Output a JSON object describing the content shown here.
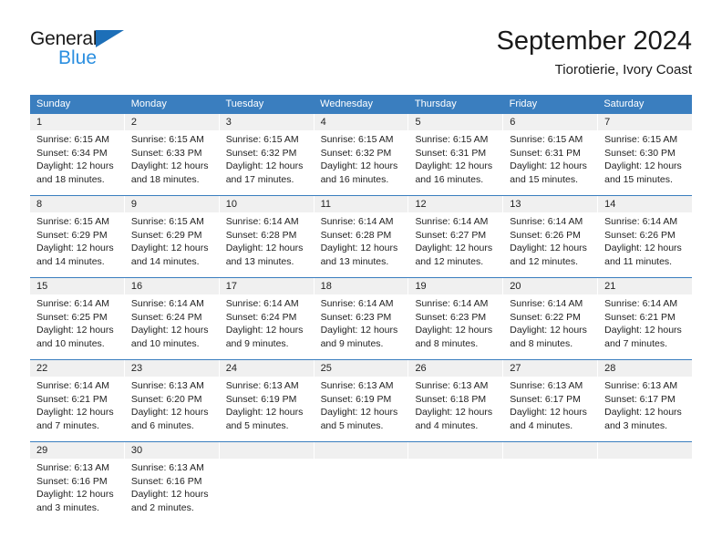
{
  "brand": {
    "line1": "General",
    "line2": "Blue",
    "triangle_color": "#1d6fb8",
    "blue_text_color": "#2b8fe0"
  },
  "header": {
    "title": "September 2024",
    "subtitle": "Tiorotierie, Ivory Coast"
  },
  "theme": {
    "header_blue": "#3a7ebf",
    "day_number_bg": "#f0f0f0",
    "text_color": "#222222"
  },
  "calendar": {
    "weekday_headers": [
      "Sunday",
      "Monday",
      "Tuesday",
      "Wednesday",
      "Thursday",
      "Friday",
      "Saturday"
    ],
    "weeks": [
      [
        {
          "day": "1",
          "sunrise": "Sunrise: 6:15 AM",
          "sunset": "Sunset: 6:34 PM",
          "daylight_1": "Daylight: 12 hours",
          "daylight_2": "and 18 minutes."
        },
        {
          "day": "2",
          "sunrise": "Sunrise: 6:15 AM",
          "sunset": "Sunset: 6:33 PM",
          "daylight_1": "Daylight: 12 hours",
          "daylight_2": "and 18 minutes."
        },
        {
          "day": "3",
          "sunrise": "Sunrise: 6:15 AM",
          "sunset": "Sunset: 6:32 PM",
          "daylight_1": "Daylight: 12 hours",
          "daylight_2": "and 17 minutes."
        },
        {
          "day": "4",
          "sunrise": "Sunrise: 6:15 AM",
          "sunset": "Sunset: 6:32 PM",
          "daylight_1": "Daylight: 12 hours",
          "daylight_2": "and 16 minutes."
        },
        {
          "day": "5",
          "sunrise": "Sunrise: 6:15 AM",
          "sunset": "Sunset: 6:31 PM",
          "daylight_1": "Daylight: 12 hours",
          "daylight_2": "and 16 minutes."
        },
        {
          "day": "6",
          "sunrise": "Sunrise: 6:15 AM",
          "sunset": "Sunset: 6:31 PM",
          "daylight_1": "Daylight: 12 hours",
          "daylight_2": "and 15 minutes."
        },
        {
          "day": "7",
          "sunrise": "Sunrise: 6:15 AM",
          "sunset": "Sunset: 6:30 PM",
          "daylight_1": "Daylight: 12 hours",
          "daylight_2": "and 15 minutes."
        }
      ],
      [
        {
          "day": "8",
          "sunrise": "Sunrise: 6:15 AM",
          "sunset": "Sunset: 6:29 PM",
          "daylight_1": "Daylight: 12 hours",
          "daylight_2": "and 14 minutes."
        },
        {
          "day": "9",
          "sunrise": "Sunrise: 6:15 AM",
          "sunset": "Sunset: 6:29 PM",
          "daylight_1": "Daylight: 12 hours",
          "daylight_2": "and 14 minutes."
        },
        {
          "day": "10",
          "sunrise": "Sunrise: 6:14 AM",
          "sunset": "Sunset: 6:28 PM",
          "daylight_1": "Daylight: 12 hours",
          "daylight_2": "and 13 minutes."
        },
        {
          "day": "11",
          "sunrise": "Sunrise: 6:14 AM",
          "sunset": "Sunset: 6:28 PM",
          "daylight_1": "Daylight: 12 hours",
          "daylight_2": "and 13 minutes."
        },
        {
          "day": "12",
          "sunrise": "Sunrise: 6:14 AM",
          "sunset": "Sunset: 6:27 PM",
          "daylight_1": "Daylight: 12 hours",
          "daylight_2": "and 12 minutes."
        },
        {
          "day": "13",
          "sunrise": "Sunrise: 6:14 AM",
          "sunset": "Sunset: 6:26 PM",
          "daylight_1": "Daylight: 12 hours",
          "daylight_2": "and 12 minutes."
        },
        {
          "day": "14",
          "sunrise": "Sunrise: 6:14 AM",
          "sunset": "Sunset: 6:26 PM",
          "daylight_1": "Daylight: 12 hours",
          "daylight_2": "and 11 minutes."
        }
      ],
      [
        {
          "day": "15",
          "sunrise": "Sunrise: 6:14 AM",
          "sunset": "Sunset: 6:25 PM",
          "daylight_1": "Daylight: 12 hours",
          "daylight_2": "and 10 minutes."
        },
        {
          "day": "16",
          "sunrise": "Sunrise: 6:14 AM",
          "sunset": "Sunset: 6:24 PM",
          "daylight_1": "Daylight: 12 hours",
          "daylight_2": "and 10 minutes."
        },
        {
          "day": "17",
          "sunrise": "Sunrise: 6:14 AM",
          "sunset": "Sunset: 6:24 PM",
          "daylight_1": "Daylight: 12 hours",
          "daylight_2": "and 9 minutes."
        },
        {
          "day": "18",
          "sunrise": "Sunrise: 6:14 AM",
          "sunset": "Sunset: 6:23 PM",
          "daylight_1": "Daylight: 12 hours",
          "daylight_2": "and 9 minutes."
        },
        {
          "day": "19",
          "sunrise": "Sunrise: 6:14 AM",
          "sunset": "Sunset: 6:23 PM",
          "daylight_1": "Daylight: 12 hours",
          "daylight_2": "and 8 minutes."
        },
        {
          "day": "20",
          "sunrise": "Sunrise: 6:14 AM",
          "sunset": "Sunset: 6:22 PM",
          "daylight_1": "Daylight: 12 hours",
          "daylight_2": "and 8 minutes."
        },
        {
          "day": "21",
          "sunrise": "Sunrise: 6:14 AM",
          "sunset": "Sunset: 6:21 PM",
          "daylight_1": "Daylight: 12 hours",
          "daylight_2": "and 7 minutes."
        }
      ],
      [
        {
          "day": "22",
          "sunrise": "Sunrise: 6:14 AM",
          "sunset": "Sunset: 6:21 PM",
          "daylight_1": "Daylight: 12 hours",
          "daylight_2": "and 7 minutes."
        },
        {
          "day": "23",
          "sunrise": "Sunrise: 6:13 AM",
          "sunset": "Sunset: 6:20 PM",
          "daylight_1": "Daylight: 12 hours",
          "daylight_2": "and 6 minutes."
        },
        {
          "day": "24",
          "sunrise": "Sunrise: 6:13 AM",
          "sunset": "Sunset: 6:19 PM",
          "daylight_1": "Daylight: 12 hours",
          "daylight_2": "and 5 minutes."
        },
        {
          "day": "25",
          "sunrise": "Sunrise: 6:13 AM",
          "sunset": "Sunset: 6:19 PM",
          "daylight_1": "Daylight: 12 hours",
          "daylight_2": "and 5 minutes."
        },
        {
          "day": "26",
          "sunrise": "Sunrise: 6:13 AM",
          "sunset": "Sunset: 6:18 PM",
          "daylight_1": "Daylight: 12 hours",
          "daylight_2": "and 4 minutes."
        },
        {
          "day": "27",
          "sunrise": "Sunrise: 6:13 AM",
          "sunset": "Sunset: 6:17 PM",
          "daylight_1": "Daylight: 12 hours",
          "daylight_2": "and 4 minutes."
        },
        {
          "day": "28",
          "sunrise": "Sunrise: 6:13 AM",
          "sunset": "Sunset: 6:17 PM",
          "daylight_1": "Daylight: 12 hours",
          "daylight_2": "and 3 minutes."
        }
      ],
      [
        {
          "day": "29",
          "sunrise": "Sunrise: 6:13 AM",
          "sunset": "Sunset: 6:16 PM",
          "daylight_1": "Daylight: 12 hours",
          "daylight_2": "and 3 minutes."
        },
        {
          "day": "30",
          "sunrise": "Sunrise: 6:13 AM",
          "sunset": "Sunset: 6:16 PM",
          "daylight_1": "Daylight: 12 hours",
          "daylight_2": "and 2 minutes."
        },
        {
          "day": "",
          "sunrise": "",
          "sunset": "",
          "daylight_1": "",
          "daylight_2": ""
        },
        {
          "day": "",
          "sunrise": "",
          "sunset": "",
          "daylight_1": "",
          "daylight_2": ""
        },
        {
          "day": "",
          "sunrise": "",
          "sunset": "",
          "daylight_1": "",
          "daylight_2": ""
        },
        {
          "day": "",
          "sunrise": "",
          "sunset": "",
          "daylight_1": "",
          "daylight_2": ""
        },
        {
          "day": "",
          "sunrise": "",
          "sunset": "",
          "daylight_1": "",
          "daylight_2": ""
        }
      ]
    ]
  }
}
